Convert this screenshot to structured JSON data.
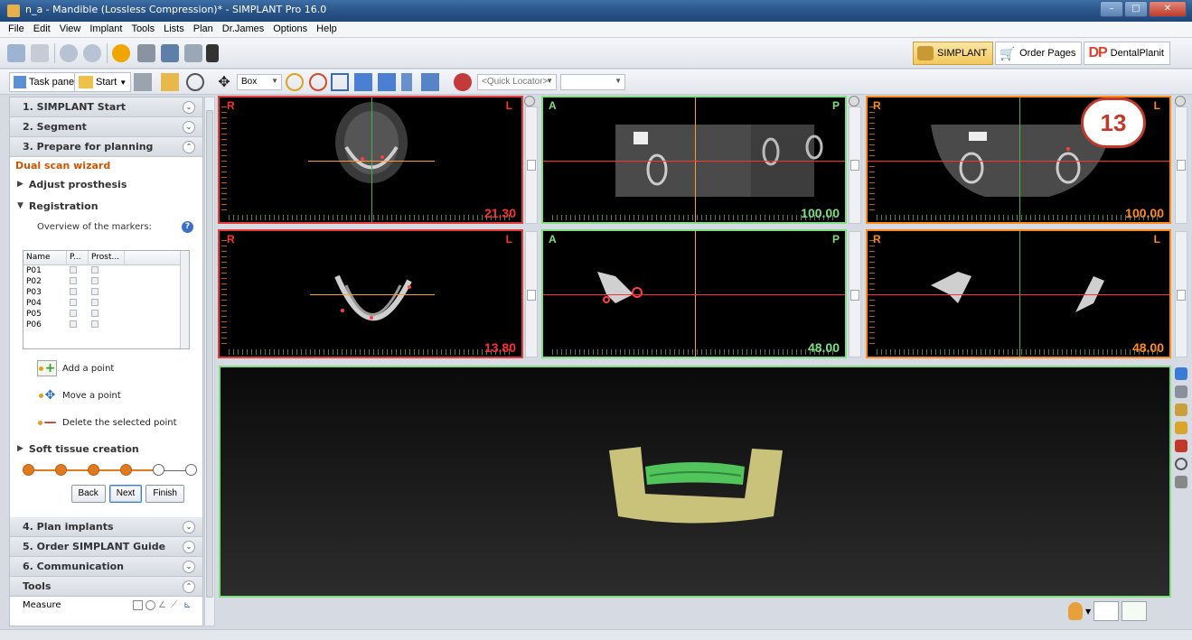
{
  "window": {
    "title": "n_a - Mandible (Lossless Compression)* - SIMPLANT Pro 16.0"
  },
  "menu": [
    "File",
    "Edit",
    "View",
    "Implant",
    "Tools",
    "Lists",
    "Plan",
    "Dr.James",
    "Options",
    "Help"
  ],
  "mode_tabs": {
    "simplant": "SIMPLANT",
    "order": "Order Pages",
    "dentalplanit": "DentalPlanit"
  },
  "toolbar2": {
    "task_panel": "Task panel",
    "start": "Start",
    "box": "Box",
    "quick_locator": "<Quick Locator>"
  },
  "panel": {
    "s1": "1. SIMPLANT Start",
    "s2": "2. Segment",
    "s3": "3. Prepare for planning",
    "wizard": "Dual scan wizard",
    "adjust": "Adjust prosthesis",
    "registration": "Registration",
    "overview": "Overview of the markers:",
    "table": {
      "headers": [
        "Name",
        "P...",
        "Prost..."
      ],
      "rows": [
        "P01",
        "P02",
        "P03",
        "P04",
        "P05",
        "P06"
      ]
    },
    "add_point": "Add a point",
    "move_point": "Move a point",
    "delete_point": "Delete the selected point",
    "soft_tissue": "Soft tissue creation",
    "btn_back": "Back",
    "btn_next": "Next",
    "btn_finish": "Finish",
    "s4": "4. Plan implants",
    "s5": "5. Order SIMPLANT Guide",
    "s6": "6. Communication",
    "tools": "Tools",
    "measure": "Measure"
  },
  "viewports": {
    "v1": {
      "left": "R",
      "right": "L",
      "value": "21.30"
    },
    "v2": {
      "left": "A",
      "right": "P",
      "value": "100.00"
    },
    "v3": {
      "left": "R",
      "right": "L",
      "value": "100.00"
    },
    "v4": {
      "left": "R",
      "right": "L",
      "value": "13.80"
    },
    "v5": {
      "left": "A",
      "right": "P",
      "value": "48.00"
    },
    "v6": {
      "left": "R",
      "right": "L",
      "value": "48.00"
    }
  },
  "badge": "13",
  "colors": {
    "red": "#e53b3b",
    "green": "#7fe07f",
    "orange": "#ff8a1c",
    "wizard": "#d35400"
  }
}
